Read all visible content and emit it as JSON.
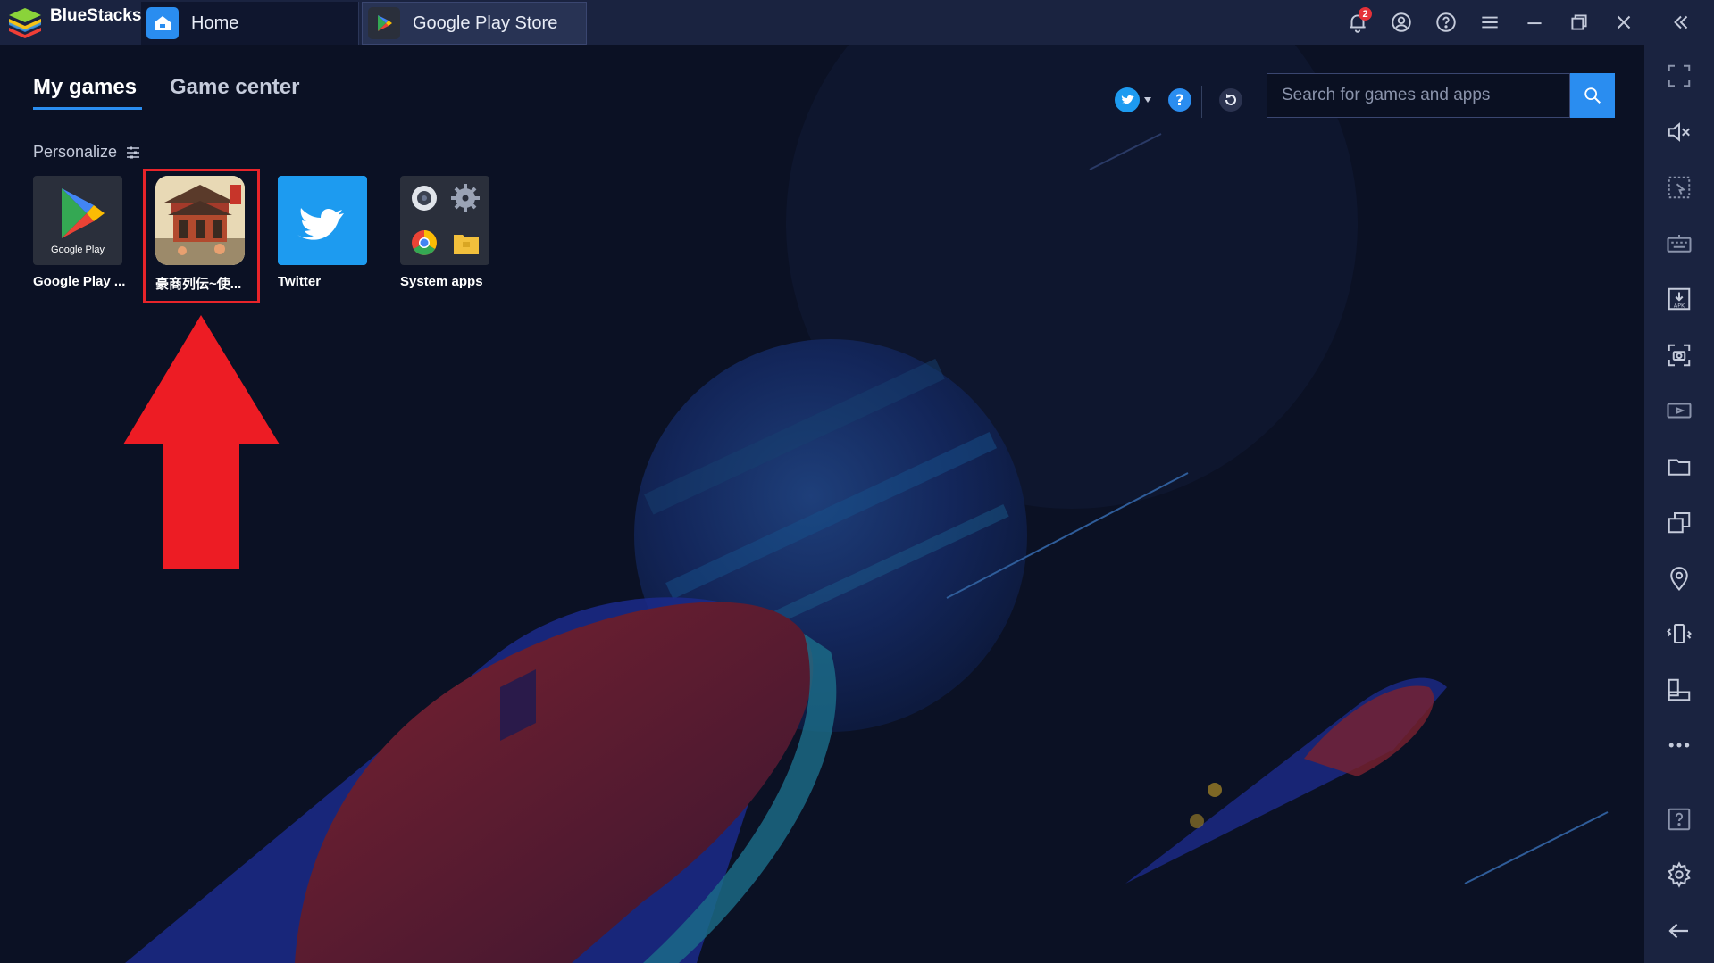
{
  "titlebar": {
    "brand": "BlueStacks",
    "tabs": [
      {
        "label": "Home",
        "icon": "home-icon"
      },
      {
        "label": "Google Play Store",
        "icon": "google-play-icon"
      }
    ],
    "notification_count": "2"
  },
  "nav": {
    "tabs": [
      {
        "label": "My games",
        "active": true
      },
      {
        "label": "Game center",
        "active": false
      }
    ]
  },
  "search": {
    "placeholder": "Search for games and apps",
    "value": ""
  },
  "personalize": {
    "label": "Personalize"
  },
  "apps": [
    {
      "label": "Google Play ...",
      "icon": "google-play-icon"
    },
    {
      "label": "豪商列伝~使...",
      "icon": "game-icon",
      "highlighted": true
    },
    {
      "label": "Twitter",
      "icon": "twitter-icon"
    },
    {
      "label": "System apps",
      "icon": "system-apps-icon"
    }
  ],
  "app_tile_text": {
    "google_play": "Google Play"
  },
  "colors": {
    "accent": "#2a8df0",
    "highlight": "#e8242a",
    "background": "#0b1124",
    "sidebar": "#1a2340"
  }
}
